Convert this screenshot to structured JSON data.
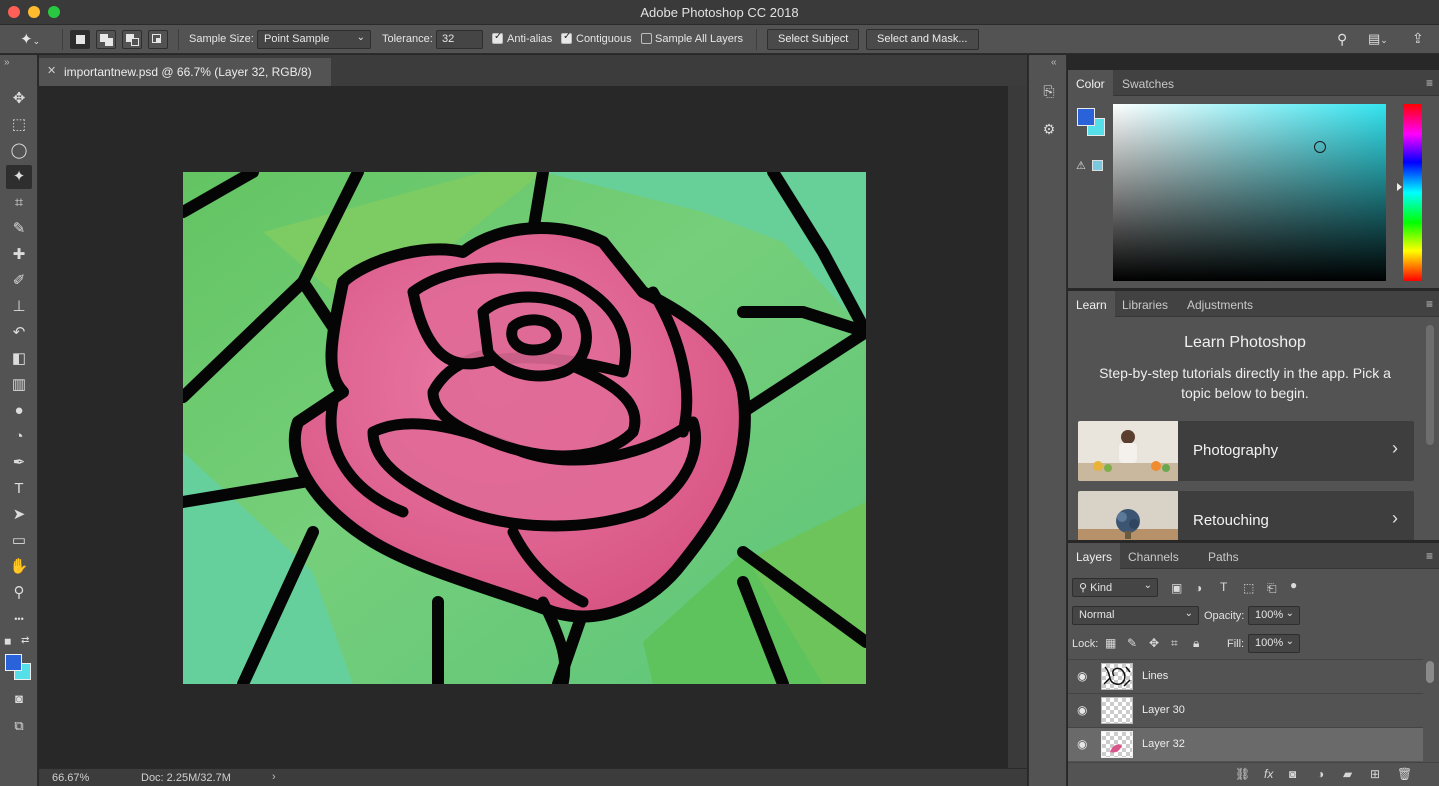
{
  "app": {
    "title": "Adobe Photoshop CC 2018"
  },
  "options_bar": {
    "sample_size_label": "Sample Size:",
    "sample_size_value": "Point Sample",
    "tolerance_label": "Tolerance:",
    "tolerance_value": "32",
    "anti_alias_label": "Anti-alias",
    "anti_alias_checked": true,
    "contiguous_label": "Contiguous",
    "contiguous_checked": true,
    "sample_all_layers_label": "Sample All Layers",
    "sample_all_layers_checked": false,
    "select_subject_label": "Select Subject",
    "select_and_mask_label": "Select and Mask..."
  },
  "tools": [
    {
      "name": "move-tool",
      "glyph": "✥"
    },
    {
      "name": "marquee-tool",
      "glyph": "⬚"
    },
    {
      "name": "lasso-tool",
      "glyph": "◯"
    },
    {
      "name": "magic-wand-tool",
      "glyph": "✦",
      "active": true
    },
    {
      "name": "crop-tool",
      "glyph": "⌗"
    },
    {
      "name": "eyedropper-tool",
      "glyph": "✎"
    },
    {
      "name": "healing-brush-tool",
      "glyph": "✚"
    },
    {
      "name": "brush-tool",
      "glyph": "✐"
    },
    {
      "name": "clone-stamp-tool",
      "glyph": "⊥"
    },
    {
      "name": "history-brush-tool",
      "glyph": "↶"
    },
    {
      "name": "eraser-tool",
      "glyph": "◧"
    },
    {
      "name": "gradient-tool",
      "glyph": "▥"
    },
    {
      "name": "blur-tool",
      "glyph": "●"
    },
    {
      "name": "dodge-tool",
      "glyph": "◔"
    },
    {
      "name": "pen-tool",
      "glyph": "✒"
    },
    {
      "name": "type-tool",
      "glyph": "T"
    },
    {
      "name": "path-selection-tool",
      "glyph": "➤"
    },
    {
      "name": "rectangle-tool",
      "glyph": "▭"
    },
    {
      "name": "hand-tool",
      "glyph": "✋"
    },
    {
      "name": "zoom-tool",
      "glyph": "⚲"
    },
    {
      "name": "more-tools",
      "glyph": "•••"
    }
  ],
  "colors": {
    "foreground": "#2962d9",
    "background": "#55dfe8"
  },
  "document": {
    "tab_label": "importantnew.psd @ 66.7% (Layer 32, RGB/8)"
  },
  "status": {
    "zoom": "66.67%",
    "doc_size": "Doc: 2.25M/32.7M"
  },
  "color_panel": {
    "tabs": [
      "Color",
      "Swatches"
    ]
  },
  "learn_panel": {
    "tabs": [
      "Learn",
      "Libraries",
      "Adjustments"
    ],
    "title": "Learn Photoshop",
    "description": "Step-by-step tutorials directly in the app. Pick a topic below to begin.",
    "cards": [
      {
        "label": "Photography"
      },
      {
        "label": "Retouching"
      }
    ]
  },
  "layers_panel": {
    "tabs": [
      "Layers",
      "Channels",
      "Paths"
    ],
    "filter_kind": "Kind",
    "blend_mode": "Normal",
    "opacity_label": "Opacity:",
    "opacity_value": "100%",
    "lock_label": "Lock:",
    "fill_label": "Fill:",
    "fill_value": "100%",
    "layers": [
      {
        "name": "Lines",
        "selected": false
      },
      {
        "name": "Layer 30",
        "selected": false
      },
      {
        "name": "Layer 32",
        "selected": true
      }
    ]
  }
}
